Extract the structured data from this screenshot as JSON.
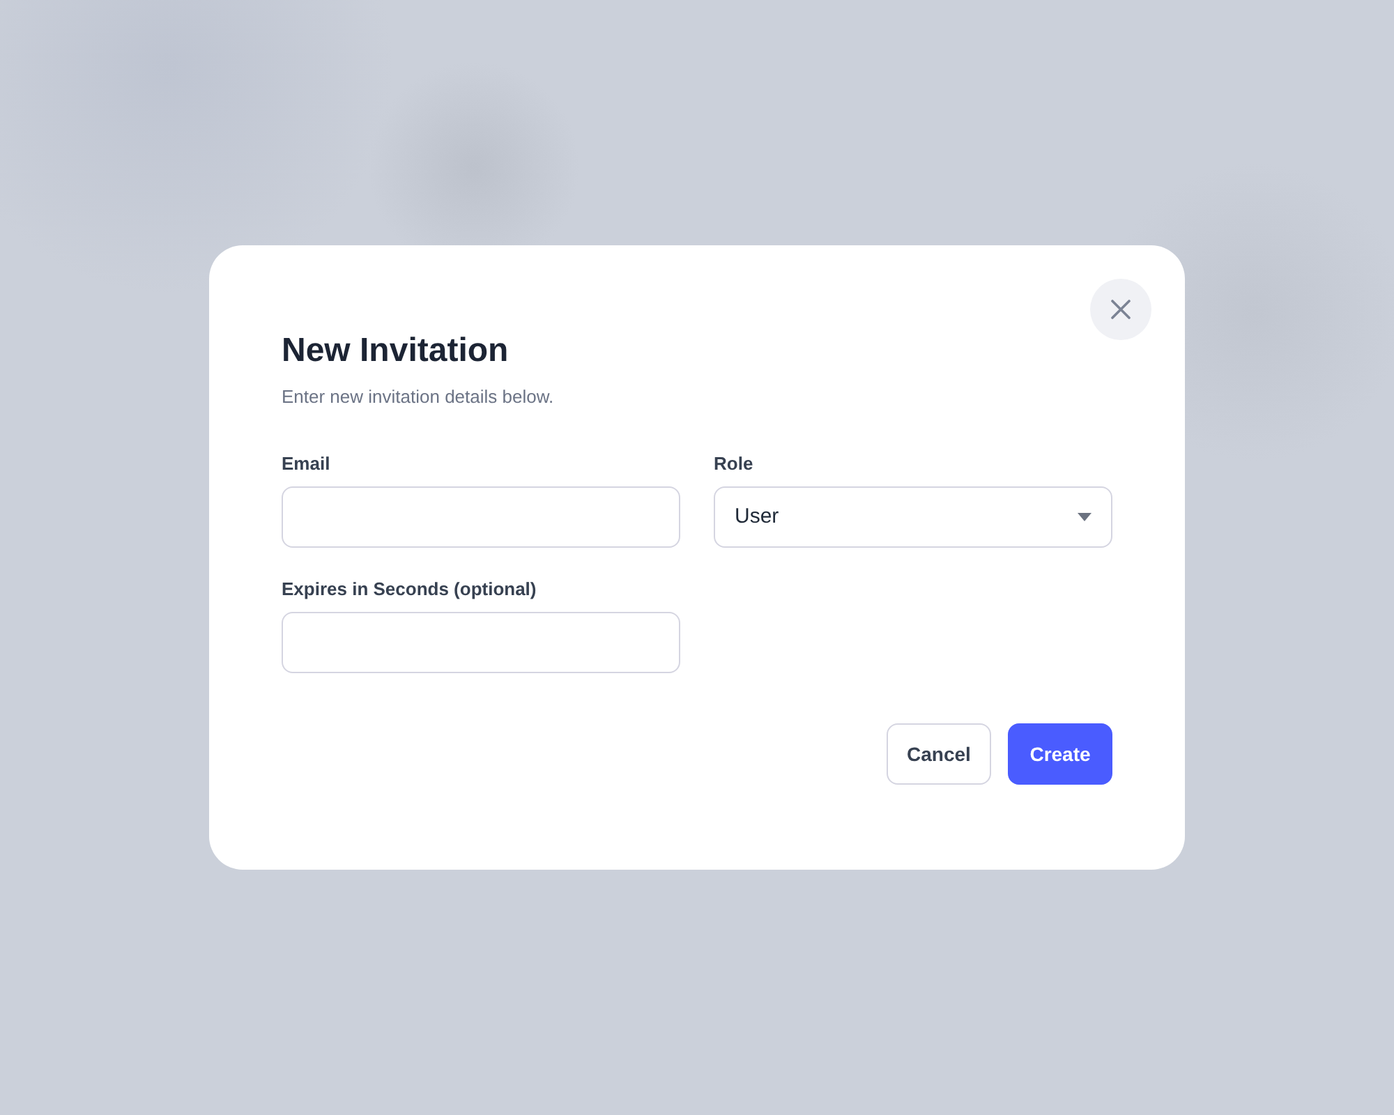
{
  "dialog": {
    "title": "New Invitation",
    "subtitle": "Enter new invitation details below.",
    "fields": [
      {
        "kind": "text",
        "label": "Email"
      },
      {
        "kind": "select",
        "label": "Role",
        "value": "User"
      },
      {
        "kind": "text",
        "label": "Expires in Seconds (optional)"
      }
    ],
    "buttons": [
      {
        "kind": "secondary",
        "label": "Cancel"
      },
      {
        "kind": "primary",
        "label": "Create"
      }
    ]
  }
}
